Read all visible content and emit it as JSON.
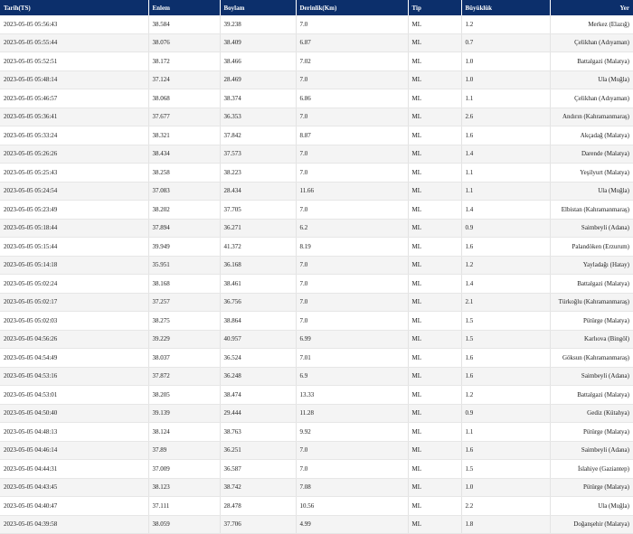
{
  "table": {
    "columns": [
      "Tarih(TS)",
      "Enlem",
      "Boylam",
      "Derinlik(Km)",
      "Tip",
      "Büyüklük",
      "Yer"
    ],
    "rows": [
      [
        "2023-05-05 05:56:43",
        "38.584",
        "39.238",
        "7.0",
        "ML",
        "1.2",
        "Merkez (Elazığ)"
      ],
      [
        "2023-05-05 05:55:44",
        "38.076",
        "38.409",
        "6.87",
        "ML",
        "0.7",
        "Çelikhan (Adıyaman)"
      ],
      [
        "2023-05-05 05:52:51",
        "38.172",
        "38.466",
        "7.02",
        "ML",
        "1.0",
        "Battalgazi (Malatya)"
      ],
      [
        "2023-05-05 05:48:14",
        "37.124",
        "28.469",
        "7.0",
        "ML",
        "1.0",
        "Ula (Muğla)"
      ],
      [
        "2023-05-05 05:46:57",
        "38.068",
        "38.374",
        "6.86",
        "ML",
        "1.1",
        "Çelikhan (Adıyaman)"
      ],
      [
        "2023-05-05 05:36:41",
        "37.677",
        "36.353",
        "7.0",
        "ML",
        "2.6",
        "Andırın (Kahramanmaraş)"
      ],
      [
        "2023-05-05 05:33:24",
        "38.321",
        "37.842",
        "8.87",
        "ML",
        "1.6",
        "Akçadağ (Malatya)"
      ],
      [
        "2023-05-05 05:26:26",
        "38.434",
        "37.573",
        "7.0",
        "ML",
        "1.4",
        "Darende (Malatya)"
      ],
      [
        "2023-05-05 05:25:43",
        "38.258",
        "38.223",
        "7.0",
        "ML",
        "1.1",
        "Yeşilyurt (Malatya)"
      ],
      [
        "2023-05-05 05:24:54",
        "37.083",
        "28.434",
        "11.66",
        "ML",
        "1.1",
        "Ula (Muğla)"
      ],
      [
        "2023-05-05 05:23:49",
        "38.202",
        "37.705",
        "7.0",
        "ML",
        "1.4",
        "Elbistan (Kahramanmaraş)"
      ],
      [
        "2023-05-05 05:18:44",
        "37.894",
        "36.271",
        "6.2",
        "ML",
        "0.9",
        "Saimbeyli (Adana)"
      ],
      [
        "2023-05-05 05:15:44",
        "39.949",
        "41.372",
        "8.19",
        "ML",
        "1.6",
        "Palandöken (Erzurum)"
      ],
      [
        "2023-05-05 05:14:18",
        "35.951",
        "36.168",
        "7.0",
        "ML",
        "1.2",
        "Yayladağı (Hatay)"
      ],
      [
        "2023-05-05 05:02:24",
        "38.168",
        "38.461",
        "7.0",
        "ML",
        "1.4",
        "Battalgazi (Malatya)"
      ],
      [
        "2023-05-05 05:02:17",
        "37.257",
        "36.756",
        "7.0",
        "ML",
        "2.1",
        "Türkoğlu (Kahramanmaraş)"
      ],
      [
        "2023-05-05 05:02:03",
        "38.275",
        "38.864",
        "7.0",
        "ML",
        "1.5",
        "Pütürge (Malatya)"
      ],
      [
        "2023-05-05 04:56:26",
        "39.229",
        "40.957",
        "6.99",
        "ML",
        "1.5",
        "Karlıova (Bingöl)"
      ],
      [
        "2023-05-05 04:54:49",
        "38.037",
        "36.524",
        "7.01",
        "ML",
        "1.6",
        "Göksun (Kahramanmaraş)"
      ],
      [
        "2023-05-05 04:53:16",
        "37.872",
        "36.248",
        "6.9",
        "ML",
        "1.6",
        "Saimbeyli (Adana)"
      ],
      [
        "2023-05-05 04:53:01",
        "38.205",
        "38.474",
        "13.33",
        "ML",
        "1.2",
        "Battalgazi (Malatya)"
      ],
      [
        "2023-05-05 04:50:40",
        "39.139",
        "29.444",
        "11.28",
        "ML",
        "0.9",
        "Gediz (Kütahya)"
      ],
      [
        "2023-05-05 04:48:13",
        "38.124",
        "38.763",
        "9.92",
        "ML",
        "1.1",
        "Pütürge (Malatya)"
      ],
      [
        "2023-05-05 04:46:14",
        "37.89",
        "36.251",
        "7.0",
        "ML",
        "1.6",
        "Saimbeyli (Adana)"
      ],
      [
        "2023-05-05 04:44:31",
        "37.009",
        "36.587",
        "7.0",
        "ML",
        "1.5",
        "İslahiye (Gaziantep)"
      ],
      [
        "2023-05-05 04:43:45",
        "38.123",
        "38.742",
        "7.08",
        "ML",
        "1.0",
        "Pütürge (Malatya)"
      ],
      [
        "2023-05-05 04:40:47",
        "37.111",
        "28.478",
        "10.56",
        "ML",
        "2.2",
        "Ula (Muğla)"
      ],
      [
        "2023-05-05 04:39:58",
        "38.059",
        "37.706",
        "4.99",
        "ML",
        "1.8",
        "Doğanşehir (Malatya)"
      ]
    ]
  }
}
